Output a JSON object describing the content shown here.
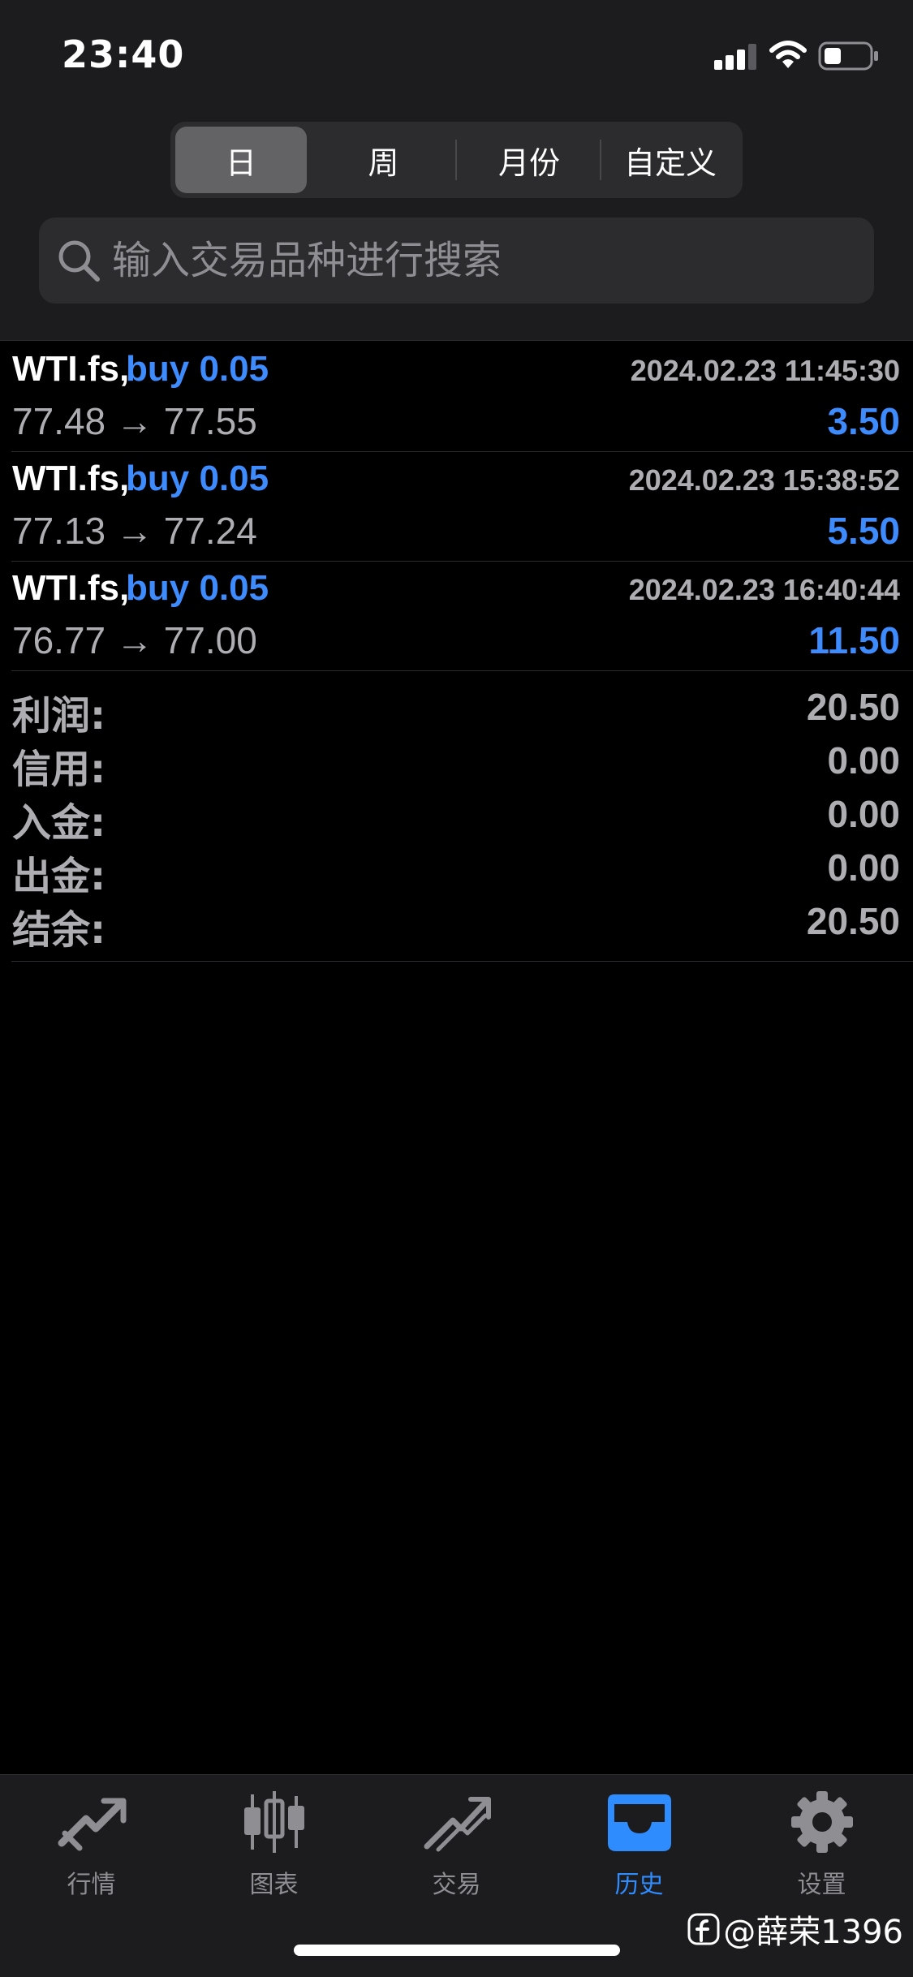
{
  "status_bar": {
    "time": "23:40"
  },
  "period_tabs": [
    {
      "label": "日",
      "active": true
    },
    {
      "label": "周",
      "active": false
    },
    {
      "label": "月份",
      "active": false
    },
    {
      "label": "自定义",
      "active": false
    }
  ],
  "search": {
    "placeholder": "输入交易品种进行搜索",
    "value": ""
  },
  "trades": [
    {
      "symbol": "WTI.fs,",
      "type": "buy 0.05",
      "time": "2024.02.23 11:45:30",
      "prices": "77.48 → 77.55",
      "profit": "3.50"
    },
    {
      "symbol": "WTI.fs,",
      "type": "buy 0.05",
      "time": "2024.02.23 15:38:52",
      "prices": "77.13 → 77.24",
      "profit": "5.50"
    },
    {
      "symbol": "WTI.fs,",
      "type": "buy 0.05",
      "time": "2024.02.23 16:40:44",
      "prices": "76.77 → 77.00",
      "profit": "11.50"
    }
  ],
  "summary": [
    {
      "label": "利润:",
      "value": "20.50"
    },
    {
      "label": "信用:",
      "value": "0.00"
    },
    {
      "label": "入金:",
      "value": "0.00"
    },
    {
      "label": "出金:",
      "value": "0.00"
    },
    {
      "label": "结余:",
      "value": "20.50"
    }
  ],
  "tab_bar": [
    {
      "label": "行情",
      "icon": "quotes-icon",
      "active": false
    },
    {
      "label": "图表",
      "icon": "candlestick-chart-icon",
      "active": false
    },
    {
      "label": "交易",
      "icon": "trade-icon",
      "active": false
    },
    {
      "label": "历史",
      "icon": "history-inbox-icon",
      "active": true
    },
    {
      "label": "设置",
      "icon": "gear-icon",
      "active": false
    }
  ],
  "watermark": {
    "text": "@薛荣1396"
  },
  "colors": {
    "accent_blue": "#3d8bfd",
    "tab_active": "#2f8cff",
    "text_secondary": "#aeaeb2",
    "background": "#000000",
    "panel": "#1c1c1e"
  }
}
